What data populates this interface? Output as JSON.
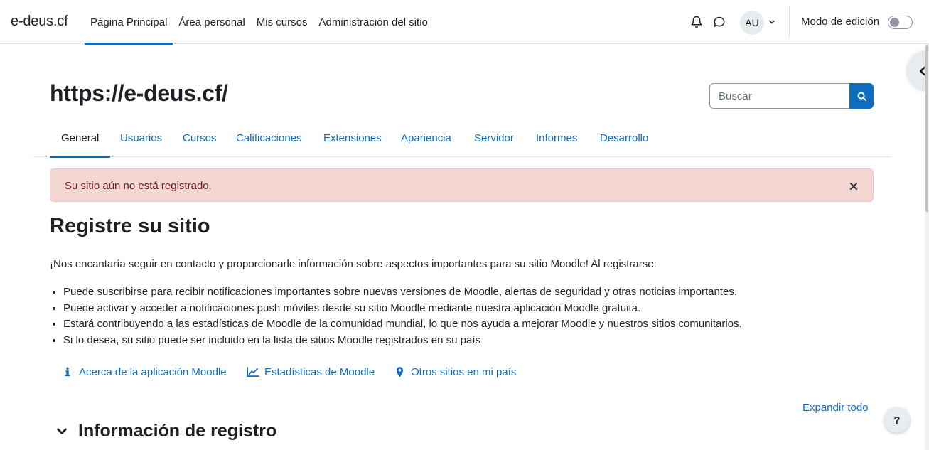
{
  "navbar": {
    "brand": "e-deus.cf",
    "items": [
      {
        "label": "Página Principal"
      },
      {
        "label": "Área personal"
      },
      {
        "label": "Mis cursos"
      },
      {
        "label": "Administración del sitio"
      }
    ],
    "avatar_initials": "AU",
    "edit_mode_label": "Modo de edición",
    "edit_mode_on": false
  },
  "header": {
    "site_title": "https://e-deus.cf/",
    "search_placeholder": "Buscar"
  },
  "secondary_nav": {
    "tabs": [
      {
        "label": "General"
      },
      {
        "label": "Usuarios"
      },
      {
        "label": "Cursos"
      },
      {
        "label": "Calificaciones"
      },
      {
        "label": "Extensiones"
      },
      {
        "label": "Apariencia"
      },
      {
        "label": "Servidor"
      },
      {
        "label": "Informes"
      },
      {
        "label": "Desarrollo"
      }
    ],
    "active": "General"
  },
  "alert": {
    "text": "Su sitio aún no está registrado."
  },
  "main": {
    "heading": "Registre su sitio",
    "intro": "¡Nos encantaría seguir en contacto y proporcionarle información sobre aspectos importantes para su sitio Moodle! Al registrarse:",
    "benefits": [
      "Puede suscribirse para recibir notificaciones importantes sobre nuevas versiones de Moodle, alertas de seguridad y otras noticias importantes.",
      "Puede activar y acceder a notificaciones push móviles desde su sitio Moodle mediante nuestra aplicación Moodle gratuita.",
      "Estará contribuyendo a las estadísticas de Moodle de la comunidad mundial, lo que nos ayuda a mejorar Moodle y nuestros sitios comunitarios.",
      "Si lo desea, su sitio puede ser incluido en la lista de sitios Moodle registrados en su país"
    ],
    "links": [
      {
        "label": "Acerca de la aplicación Moodle",
        "icon": "info-icon"
      },
      {
        "label": "Estadísticas de Moodle",
        "icon": "line-chart-icon"
      },
      {
        "label": "Otros sitios en mi país",
        "icon": "map-pin-icon"
      }
    ],
    "expand_all": "Expandir todo",
    "section_title": "Información de registro"
  },
  "help_button": "?",
  "colors": {
    "primary": "#0f6cbf",
    "alert_bg": "#f4d6d2",
    "alert_text": "#6e211a"
  }
}
